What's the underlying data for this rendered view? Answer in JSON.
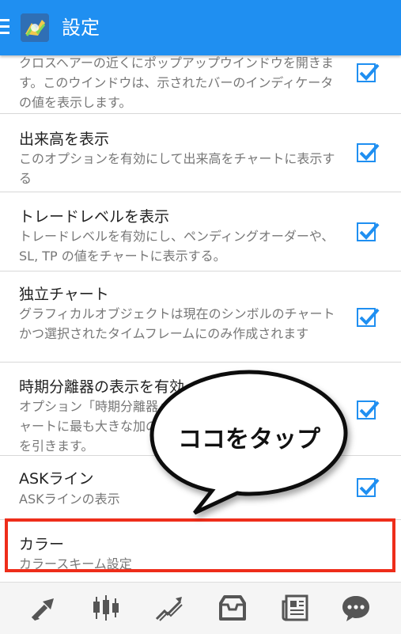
{
  "header": {
    "title": "設定"
  },
  "settings": [
    {
      "title": "",
      "summary": "クロスヘアーの近くにポップアップウインドウを開きます。このウインドウは、示されたバーのインディケータの値を表示します。",
      "checked": true
    },
    {
      "title": "出来高を表示",
      "summary": "このオプションを有効にして出来高をチャートに表示する",
      "checked": true
    },
    {
      "title": "トレードレベルを表示",
      "summary": "トレードレベルを有効にし、ペンディングオーダーや、SL, TP の値をチャートに表示する。",
      "checked": true
    },
    {
      "title": "独立チャート",
      "summary": "グラフィカルオブジェクトは現在のシンボルのチャートかつ選択されたタイムフレームにのみ作成されます",
      "checked": true
    },
    {
      "title": "時期分離器の表示を有効",
      "summary": "オプション「時期分離器」チャートに最も大きな加の縦線を引きます。",
      "checked": true
    },
    {
      "title": "ASKライン",
      "summary": "ASKラインの表示",
      "checked": true
    },
    {
      "title": "カラー",
      "summary": "カラースキーム設定"
    }
  ],
  "callout": {
    "text": "ココをタップ"
  },
  "bottom_nav": [
    "trade-icon",
    "candlestick-chart-icon",
    "trend-line-icon",
    "inbox-icon",
    "news-icon",
    "chat-icon"
  ],
  "colors": {
    "accent": "#1f8ff1",
    "highlight": "#ee2d1a"
  }
}
